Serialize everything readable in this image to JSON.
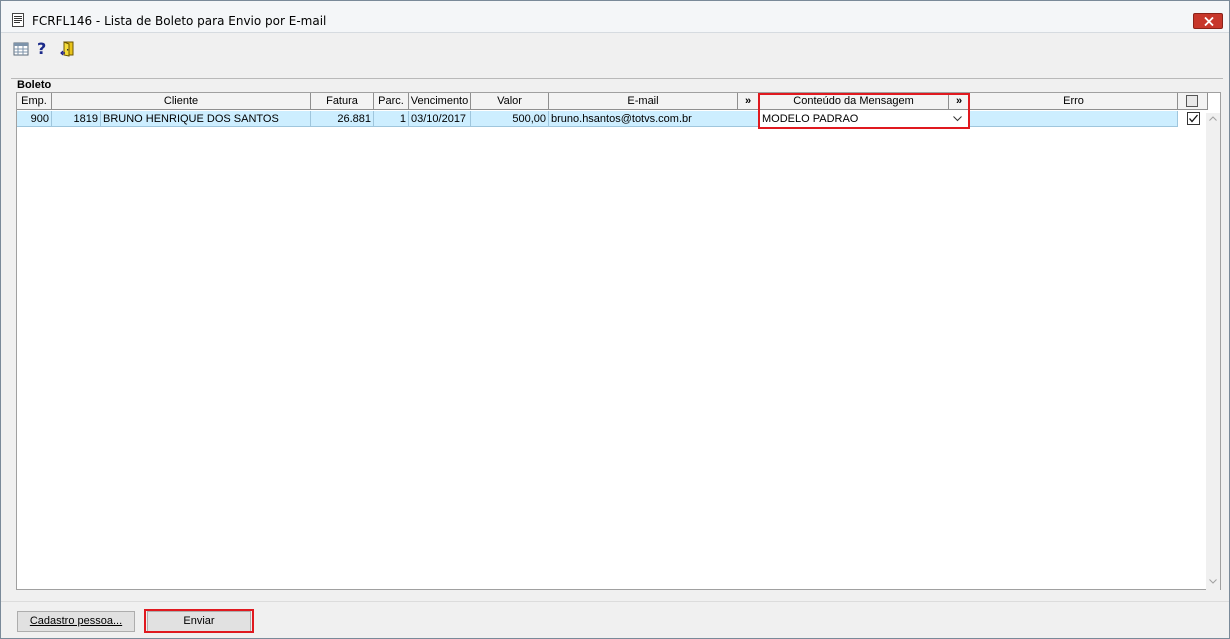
{
  "window": {
    "title": "FCRFL146 - Lista de Boleto para Envio por E-mail"
  },
  "toolbar": {
    "icons": [
      "grid-icon",
      "help-icon",
      "exit-door-icon"
    ],
    "help_glyph": "?"
  },
  "group": {
    "label": "Boleto"
  },
  "grid": {
    "columns": {
      "emp": "Emp.",
      "cliente": "Cliente",
      "fatura": "Fatura",
      "parc": "Parc.",
      "vencimento": "Vencimento",
      "valor": "Valor",
      "email": "E-mail",
      "expand1": "»",
      "conteudo": "Conteúdo da Mensagem",
      "expand2": "»",
      "erro": "Erro"
    },
    "rows": [
      {
        "emp": "900",
        "cliente_codigo": "1819",
        "cliente_nome": "BRUNO HENRIQUE DOS SANTOS",
        "fatura": "26.881",
        "parc": "1",
        "vencimento": "03/10/2017",
        "valor": "500,00",
        "email": "bruno.hsantos@totvs.com.br",
        "conteudo": "MODELO PADRAO",
        "erro": "",
        "selected": true
      }
    ]
  },
  "buttons": {
    "cadastro": "Cadastro pessoa...",
    "enviar": "Enviar"
  },
  "colors": {
    "highlight": "#e0191f",
    "row_bg": "#cdeeff",
    "close": "#c7372b"
  }
}
